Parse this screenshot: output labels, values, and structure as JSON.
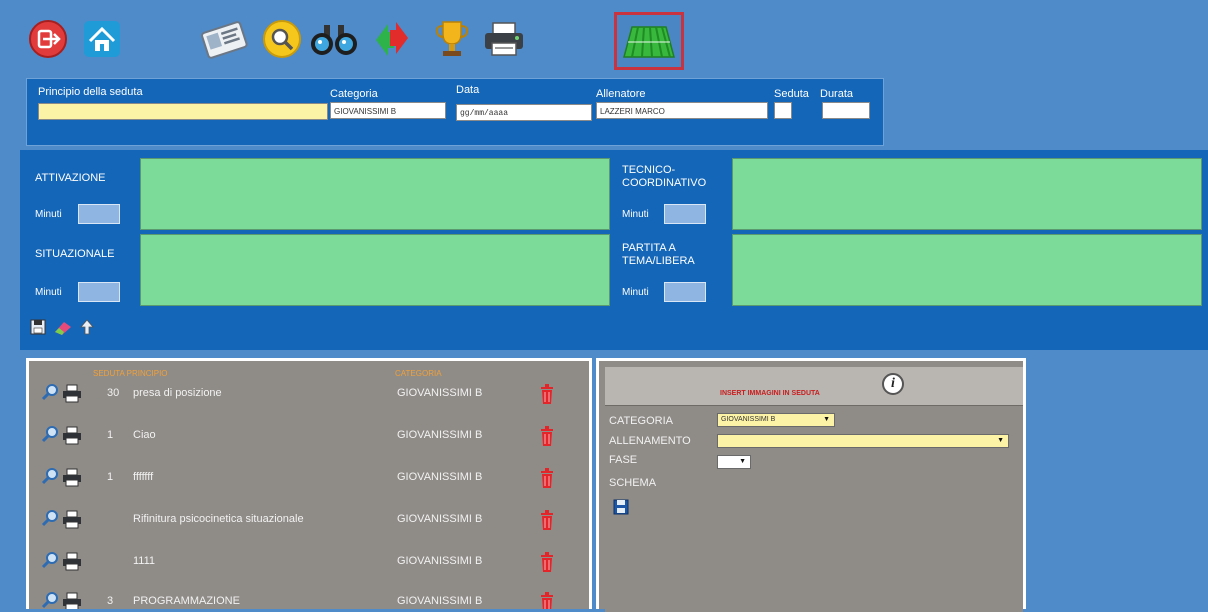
{
  "toolbar": {
    "buttons": [
      {
        "name": "exit"
      },
      {
        "name": "home"
      },
      {
        "name": "id-card"
      },
      {
        "name": "search"
      },
      {
        "name": "binoculars"
      },
      {
        "name": "transfer"
      },
      {
        "name": "trophy"
      },
      {
        "name": "print"
      },
      {
        "name": "field",
        "active": true
      }
    ]
  },
  "header": {
    "principio_label": "Principio della seduta",
    "principio_value": "",
    "categoria_label": "Categoria",
    "categoria_value": "GIOVANISSIMI B",
    "data_label": "Data",
    "data_value": "gg/mm/aaaa",
    "allenatore_label": "Allenatore",
    "allenatore_value": "LAZZERI MARCO",
    "seduta_label": "Seduta",
    "durata_label": "Durata"
  },
  "form": {
    "attivazione_label": "ATTIVAZIONE",
    "tecnico_label_1": "TECNICO-",
    "tecnico_label_2": "COORDINATIVO",
    "situazionale_label": "SITUAZIONALE",
    "partita_label_1": "PARTITA A",
    "partita_label_2": "TEMA/LIBERA",
    "minuti_label": "Minuti"
  },
  "list": {
    "col_principio": "SEDUTA PRINCIPIO",
    "col_categoria": "CATEGORIA",
    "rows": [
      {
        "num": "30",
        "name": "presa di posizione",
        "cat": "GIOVANISSIMI B"
      },
      {
        "num": "1",
        "name": "Ciao",
        "cat": "GIOVANISSIMI B"
      },
      {
        "num": "1",
        "name": "fffffff",
        "cat": "GIOVANISSIMI B"
      },
      {
        "num": "",
        "name": "Rifinitura psicocinetica situazionale",
        "cat": "GIOVANISSIMI B"
      },
      {
        "num": "",
        "name": "1111",
        "cat": "GIOVANISSIMI B"
      },
      {
        "num": "3",
        "name": "PROGRAMMAZIONE",
        "cat": "GIOVANISSIMI B"
      }
    ]
  },
  "insert": {
    "title": "INSERT IMMAGINI IN SEDUTA",
    "info": "i",
    "categoria_label": "CATEGORIA",
    "categoria_value": "GIOVANISSIMI B",
    "allenamento_label": "ALLENAMENTO",
    "allenamento_value": "",
    "fase_label": "FASE",
    "fase_value": "",
    "schema_label": "SCHEMA"
  },
  "colors": {
    "background": "#4f8ac9",
    "panel_blue": "#1466b8",
    "textarea_green": "#7ddb9a",
    "list_gray": "#8f8b87",
    "accent_orange": "#f0a13a",
    "highlight_red": "#c9323f"
  }
}
